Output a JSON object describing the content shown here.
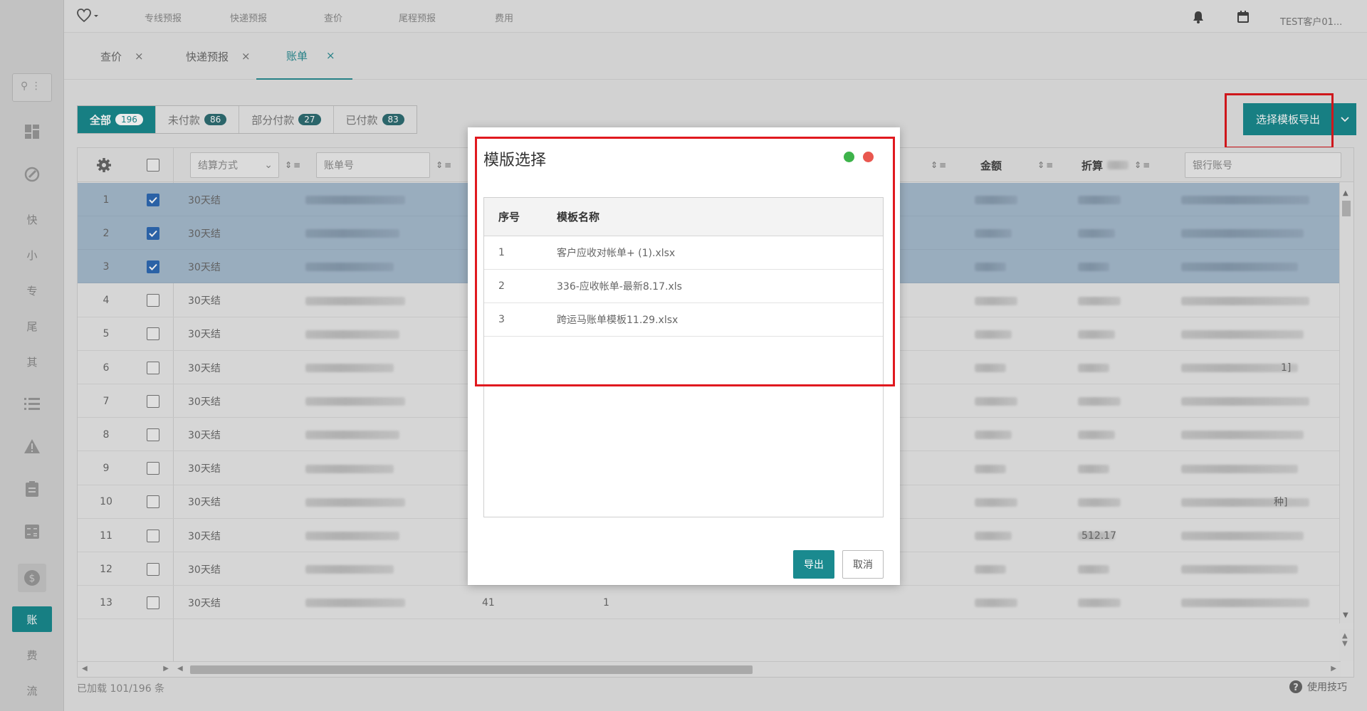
{
  "topbar": {
    "nav": [
      "专线预报",
      "快递预报",
      "查价",
      "尾程预报",
      "费用"
    ],
    "user": "TEST客户01..."
  },
  "sidebar": {
    "search_icon": "search-icon",
    "chars": [
      "快",
      "小",
      "专",
      "尾",
      "其"
    ],
    "active_char": "账",
    "bottom_chars": [
      "费",
      "流"
    ]
  },
  "tabs": [
    {
      "label": "查价",
      "close": "×"
    },
    {
      "label": "快递预报",
      "close": "×"
    },
    {
      "label": "账单",
      "close": "×"
    }
  ],
  "filters": [
    {
      "label": "全部",
      "count": "196"
    },
    {
      "label": "未付款",
      "count": "86"
    },
    {
      "label": "部分付款",
      "count": "27"
    },
    {
      "label": "已付款",
      "count": "83"
    }
  ],
  "export_button": {
    "label": "选择模板导出"
  },
  "grid": {
    "headers": {
      "settle_placeholder": "结算方式",
      "bill_placeholder": "账单号",
      "amount": "金额",
      "converted": "折算",
      "bank_placeholder": "银行账号"
    },
    "rows": [
      {
        "no": "1",
        "settle": "30天结",
        "checked": true
      },
      {
        "no": "2",
        "settle": "30天结",
        "checked": true
      },
      {
        "no": "3",
        "settle": "30天结",
        "checked": true
      },
      {
        "no": "4",
        "settle": "30天结",
        "checked": false
      },
      {
        "no": "5",
        "settle": "30天结",
        "checked": false
      },
      {
        "no": "6",
        "settle": "30天结",
        "checked": false
      },
      {
        "no": "7",
        "settle": "30天结",
        "checked": false
      },
      {
        "no": "8",
        "settle": "30天结",
        "checked": false
      },
      {
        "no": "9",
        "settle": "30天结",
        "checked": false
      },
      {
        "no": "10",
        "settle": "30天结",
        "checked": false
      },
      {
        "no": "11",
        "settle": "30天结",
        "checked": false
      },
      {
        "no": "12",
        "settle": "30天结",
        "checked": false
      },
      {
        "no": "13",
        "settle": "30天结",
        "checked": false
      }
    ],
    "row11_converted": "512.17",
    "row13_col_a": "41",
    "row13_col_b": "1",
    "row6_tail": "1]",
    "row10_tail": "种]"
  },
  "footer": {
    "loaded": "已加载 101/196 条",
    "tips": "使用技巧"
  },
  "modal": {
    "title": "模版选择",
    "columns": [
      "序号",
      "模板名称"
    ],
    "templates": [
      {
        "no": "1",
        "name": "客户应收对帐单+ (1).xlsx"
      },
      {
        "no": "2",
        "name": "336-应收帐单-最新8.17.xls"
      },
      {
        "no": "3",
        "name": "跨运马账单模板11.29.xlsx"
      }
    ],
    "ok": "导出",
    "cancel": "取消"
  },
  "colors": {
    "accent": "#1a8a8f",
    "selected_row": "#a7bccf",
    "highlight_box": "#e0191f",
    "dot_green": "#3db34a",
    "dot_red": "#e9574f"
  }
}
